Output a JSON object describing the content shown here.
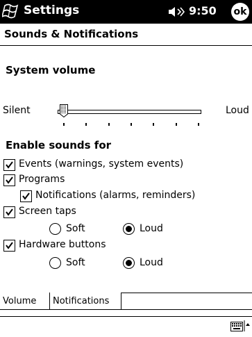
{
  "titlebar": {
    "app_title": "Settings",
    "time": "9:50",
    "ok_label": "ok"
  },
  "page": {
    "title": "Sounds & Notifications"
  },
  "system_volume": {
    "heading": "System volume",
    "min_label": "Silent",
    "max_label": "Loud",
    "level": 0,
    "ticks": 7
  },
  "enable_sounds": {
    "heading": "Enable sounds for",
    "events": {
      "label": "Events (warnings, system events)",
      "checked": true
    },
    "programs": {
      "label": "Programs",
      "checked": true
    },
    "notifications": {
      "label": "Notifications (alarms, reminders)",
      "checked": true
    },
    "screen_taps": {
      "label": "Screen taps",
      "checked": true,
      "soft_label": "Soft",
      "loud_label": "Loud",
      "selected": "Loud"
    },
    "hardware_buttons": {
      "label": "Hardware buttons",
      "checked": true,
      "soft_label": "Soft",
      "loud_label": "Loud",
      "selected": "Loud"
    }
  },
  "tabs": [
    {
      "label": "Volume",
      "active": true
    },
    {
      "label": "Notifications",
      "active": false
    }
  ],
  "icons": {
    "start": "windows-flag-icon",
    "volume": "speaker-icon",
    "keyboard": "keyboard-icon",
    "sip": "up-arrow-icon"
  },
  "colors": {
    "titlebar_bg": "#000000",
    "text": "#000000",
    "background": "#ffffff"
  }
}
